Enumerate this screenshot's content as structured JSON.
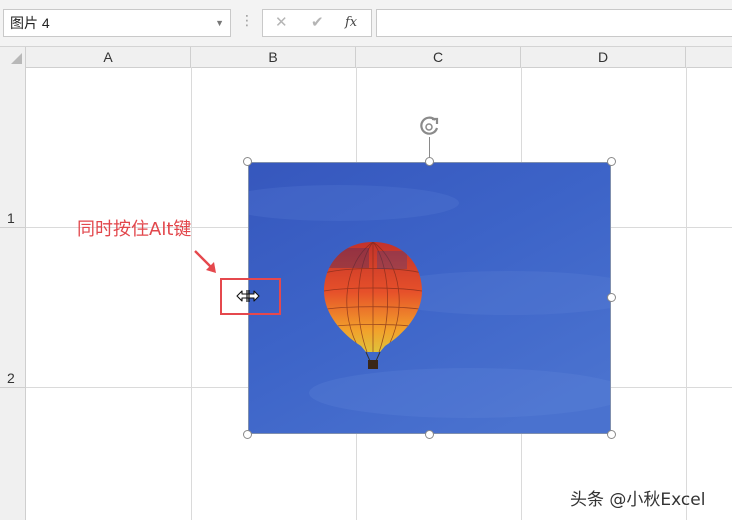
{
  "formula_bar": {
    "name_box_value": "图片 4",
    "cancel_icon": "✕",
    "enter_icon": "✔",
    "fx_label": "fx",
    "formula_value": ""
  },
  "columns": [
    "A",
    "B",
    "C",
    "D"
  ],
  "rows": [
    "1",
    "2"
  ],
  "annotation": {
    "text": "同时按住Alt键",
    "color": "#e2474c"
  },
  "picture": {
    "name": "图片 4",
    "sky_color": "#3a5bc0"
  },
  "watermark": "头条 @小秋Excel"
}
